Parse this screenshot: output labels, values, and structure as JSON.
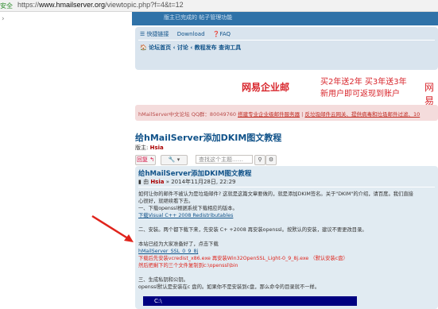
{
  "browser": {
    "secure_label": "安全",
    "url_prefix": "https://",
    "url_host": "www.hmailserver.org",
    "url_path": "/viewtopic.php?f=4&t=12"
  },
  "header": {
    "strip_text": "版主已完成的 帖子管理功能"
  },
  "nav": {
    "quicklinks": "☰ 快捷链接",
    "download": "Download",
    "faq": "❓FAQ",
    "breadcrumb": "🏠 论坛首页 ‹ 讨论 ‹ 教程发布 查询工具"
  },
  "ad": {
    "brand": "网易企业邮",
    "line1": "买2年送2年 买3年送3年",
    "line2": "新用户即可返现到账户",
    "brand_cut": "网易"
  },
  "notice": {
    "prefix": "hMailServer中文论坛 QQ群：80049760",
    "link1": "搭建专业企业级邮件服务器",
    "sep": " | ",
    "link2": "反垃圾邮件云网关、提供病毒和垃圾邮件过滤、10"
  },
  "topic": {
    "title": "给hMailServer添加DKIM图文教程",
    "moderators_label": "版主:",
    "moderator": "Hsia"
  },
  "toolbar": {
    "reply": "回复",
    "tools": "🔧 ▾",
    "search_placeholder": "查找这个主题……"
  },
  "post": {
    "title": "给hMailServer添加DKIM图文教程",
    "by": "由",
    "author": "Hsia",
    "date": "» 2014年11月28日, 22:29",
    "lines": [
      "如何让你的邮件不被认为是垃圾邮件? 这就是这篇文章要做的，就是添加DKIM签名。关于\"DKIM\"的介绍，请百度。我们直接",
      "心很好，就继续看下去。",
      "一、下载openssl根据系统下载相应的版本。",
      "下载Visual C++ 2008 Redistributables",
      "",
      "二、安装。两个都下载下来，先安装 C+ +2008 再安装openssl。按默认的安装，建议不要更改目录。",
      "",
      "本站已经为大家准备好了，点击下载",
      "hMailServer_SSL_0_9_8j",
      "下载后先安装vcredist_x86.exe 再安装Win32OpenSSL_Light-0_9_8j.exe （默认安装c盘）",
      "然后把剩下的三个文件复制到c:\\openssl\\bin",
      "",
      "三、生成私钥和公钥。",
      "openssl默认是安装在c 盘的。如果你不是安装到c盘，那么命令的目录就不一样。"
    ],
    "code_title": "C:\\"
  }
}
